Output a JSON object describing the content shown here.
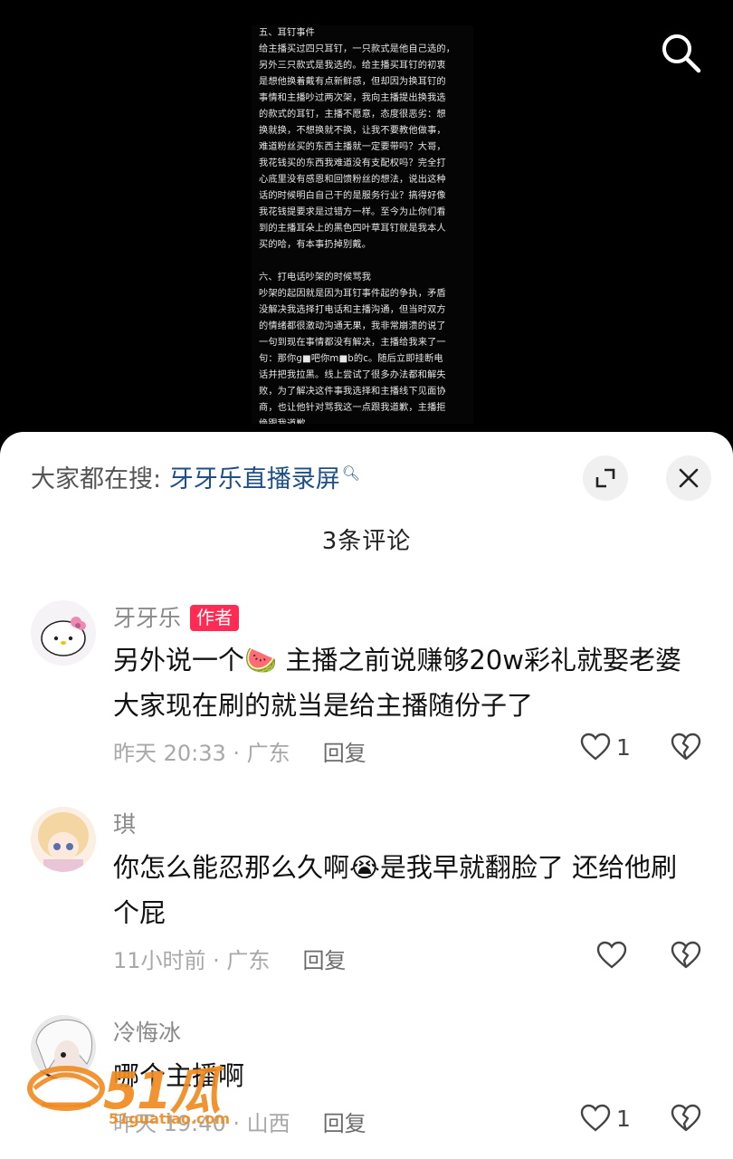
{
  "video": {
    "doc_lines": [
      "五、耳钉事件",
      "给主播买过四只耳钉，一只款式是他自己选的，",
      "另外三只款式是我选的。给主播买耳钉的初衷",
      "是想他换着戴有点新鲜感，但却因为换耳钉的",
      "事情和主播吵过两次架，我向主播提出换我选",
      "的款式的耳钉，主播不愿意，态度很恶劣：想",
      "换就换，不想换就不换，让我不要教他做事，",
      "难道粉丝买的东西主播就一定要带吗？大哥，",
      "我花钱买的东西我难道没有支配权吗？完全打",
      "心底里没有感恩和回馈粉丝的想法，说出这种",
      "话的时候明白自己干的是服务行业？搞得好像",
      "我花钱提要求是过错方一样。至今为止你们看",
      "到的主播耳朵上的黑色四叶草耳钉就是我本人",
      "买的哈，有本事扔掉别戴。",
      "",
      "六、打电话吵架的时候骂我",
      "吵架的起因就是因为耳钉事件起的争执，矛盾",
      "没解决我选择打电话和主播沟通，但当时双方",
      "的情绪都很激动沟通无果，我非常崩溃的说了",
      "一句到现在事情都没有解决，主播给我来了一",
      "句：那你g■吧你m■b的c。随后立即挂断电",
      "话并把我拉黑。线上尝试了很多办法都和解失",
      "败，为了解决这件事我选择和主播线下见面协",
      "商，也让他针对骂我这一点跟我道歉，主播拒",
      "绝跟我道歉。"
    ]
  },
  "panel": {
    "search_prefix": "大家都在搜:",
    "search_term": "牙牙乐直播录屏",
    "count_label": "3条评论",
    "comments": [
      {
        "user": "牙牙乐",
        "badge": "作者",
        "text": "另外说一个🍉 主播之前说赚够20w彩礼就娶老婆 大家现在刷的就当是给主播随份子了",
        "meta": "昨天 20:33 · 广东",
        "reply": "回复",
        "likes": "1"
      },
      {
        "user": "琪",
        "text": "你怎么能忍那么久啊😭是我早就翻脸了 还给他刷个屁",
        "meta": "11小时前 · 广东",
        "reply": "回复",
        "likes": ""
      },
      {
        "user": "冷悔冰",
        "text": "哪个主播啊",
        "meta": "昨天 19:40 · 山西",
        "reply": "回复",
        "likes": "1"
      }
    ]
  },
  "watermark": {
    "number": "51",
    "brand": "瓜",
    "url": "51guatiao.com"
  }
}
